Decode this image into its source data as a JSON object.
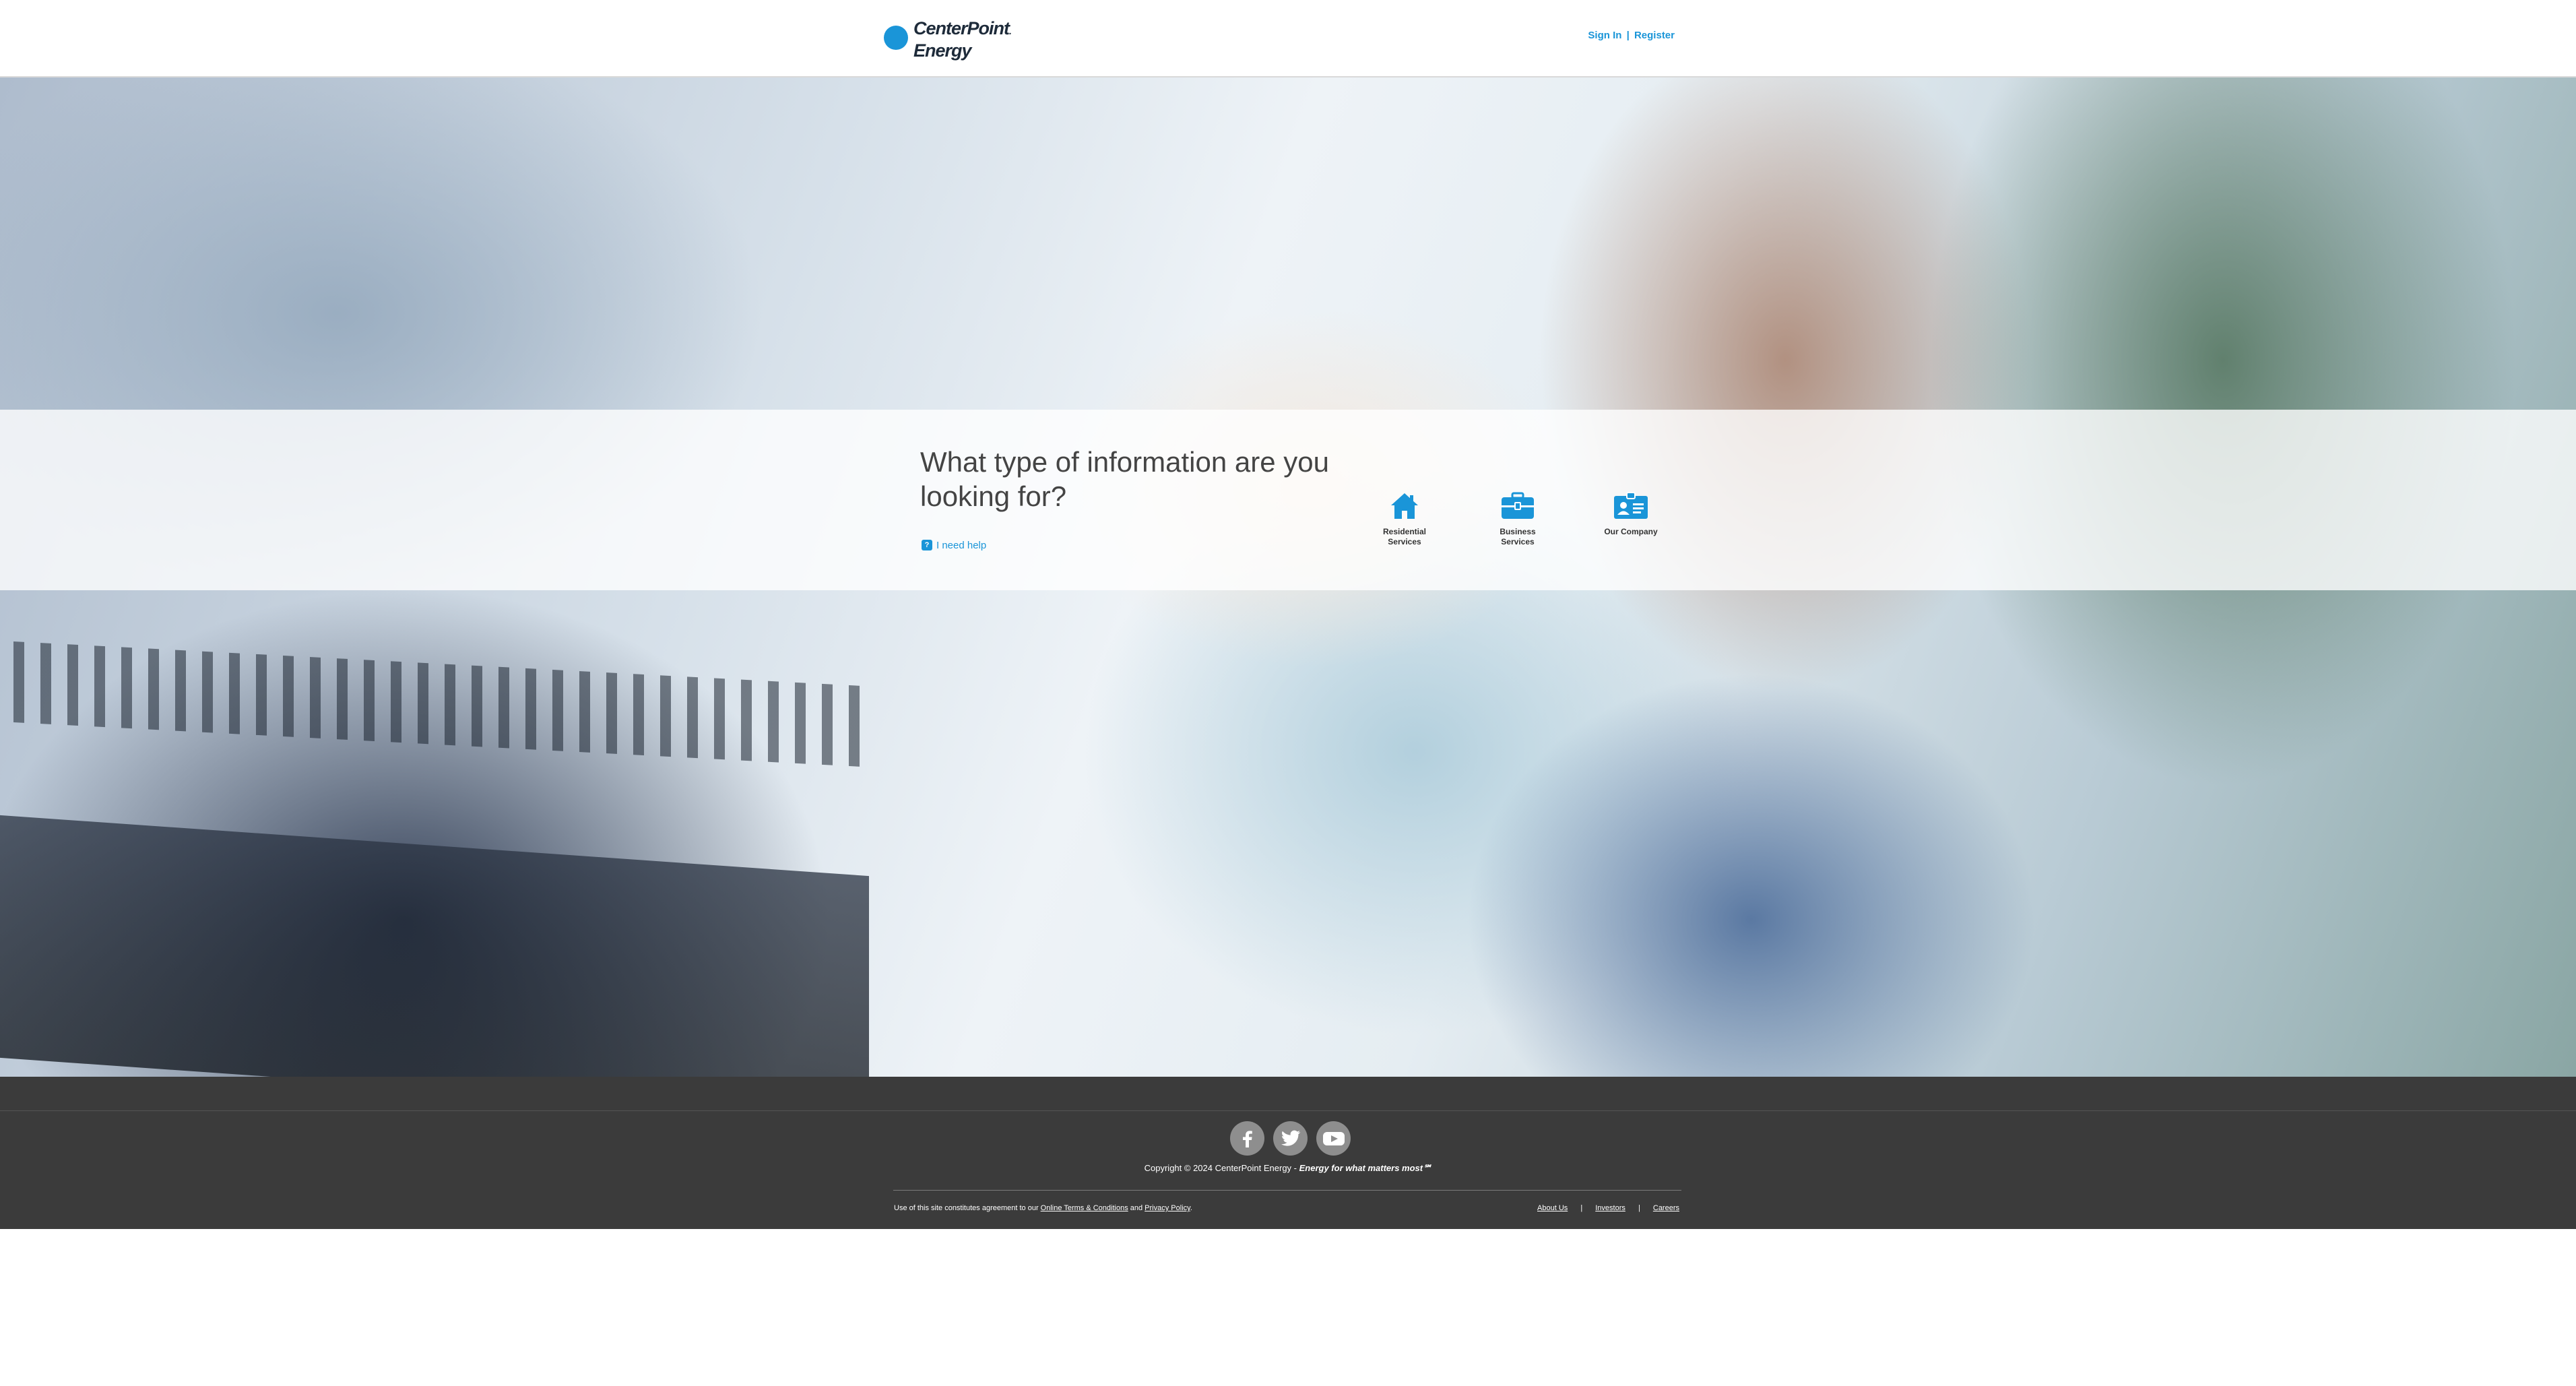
{
  "header": {
    "logo_line1": "CenterPoint",
    "logo_line2": "Energy",
    "logo_mark": ".",
    "sign_in": "Sign In",
    "separator": "|",
    "register": "Register"
  },
  "hero": {
    "question": "What type of information are you looking for?",
    "help_badge": "?",
    "help_link": "I need help",
    "categories": [
      {
        "label_line1": "Residential",
        "label_line2": "Services",
        "icon": "house-icon"
      },
      {
        "label_line1": "Business",
        "label_line2": "Services",
        "icon": "briefcase-icon"
      },
      {
        "label_line1": "Our Company",
        "label_line2": "",
        "icon": "id-card-icon"
      }
    ]
  },
  "footer": {
    "social": [
      "facebook-icon",
      "twitter-icon",
      "youtube-icon"
    ],
    "copyright_prefix": "Copyright © 2024 CenterPoint Energy - ",
    "tagline": "Energy for what matters most℠",
    "legal_prefix": "Use of this site constitutes agreement to our ",
    "terms_link": "Online Terms & Conditions",
    "legal_and": " and ",
    "privacy_link": "Privacy Policy",
    "legal_suffix": ".",
    "nav": {
      "about": "About Us",
      "investors": "Investors",
      "careers": "Careers",
      "pipe": "|"
    }
  },
  "colors": {
    "accent": "#1a95d8",
    "footer_bg": "#3b3b3b",
    "social_bg": "#8e8e8e"
  }
}
